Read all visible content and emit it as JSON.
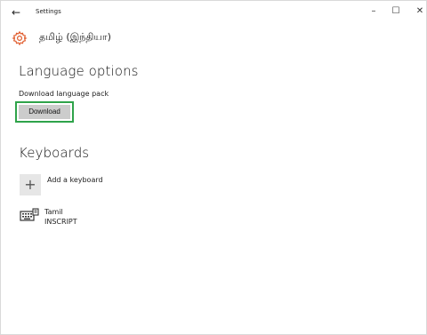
{
  "window": {
    "title": "Settings",
    "controls": {
      "minimize": "–",
      "maximize": "☐",
      "close": "✕"
    },
    "back_glyph": "←"
  },
  "header": {
    "icon": "gear-icon",
    "title": "தமிழ் (இந்தியா)"
  },
  "language_options": {
    "heading": "Language options",
    "pack_label": "Download language pack",
    "download_button": "Download",
    "highlight_color": "#2fa34a"
  },
  "keyboards": {
    "heading": "Keyboards",
    "add_label": "Add a keyboard",
    "add_glyph": "+",
    "items": [
      {
        "icon": "keyboard-icon",
        "name": "Tamil",
        "layout": "INSCRIPT"
      }
    ]
  },
  "colors": {
    "accent_gear": "#e05a2a",
    "button_bg": "#cccccc",
    "add_box_bg": "#e6e6e6"
  }
}
